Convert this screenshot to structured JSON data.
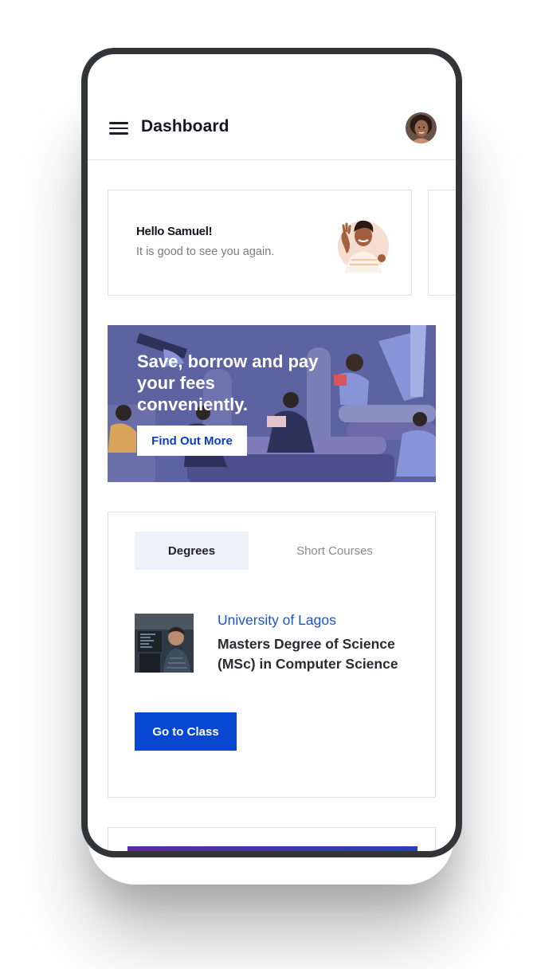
{
  "header": {
    "title": "Dashboard",
    "menu_icon": "hamburger-menu-icon",
    "avatar_icon": "user-avatar"
  },
  "greeting": {
    "hello": "Hello Samuel!",
    "subtitle": "It is good to see you again.",
    "illustration": "waving-person-icon"
  },
  "banner": {
    "title": "Save, borrow and pay your fees conveniently.",
    "cta": "Find Out More",
    "background_color": "#5d62a0"
  },
  "courses": {
    "tabs": [
      {
        "label": "Degrees",
        "active": true
      },
      {
        "label": "Short Courses",
        "active": false
      }
    ],
    "item": {
      "university": "University of Lagos",
      "name": "Masters Degree of Science (MSc) in Computer Science",
      "image": "student-at-computer-photo"
    },
    "action": "Go to Class"
  },
  "colors": {
    "primary": "#0847d1",
    "link": "#1854c9",
    "tab_active_bg": "#edf2fb",
    "title_text": "#14142b"
  }
}
